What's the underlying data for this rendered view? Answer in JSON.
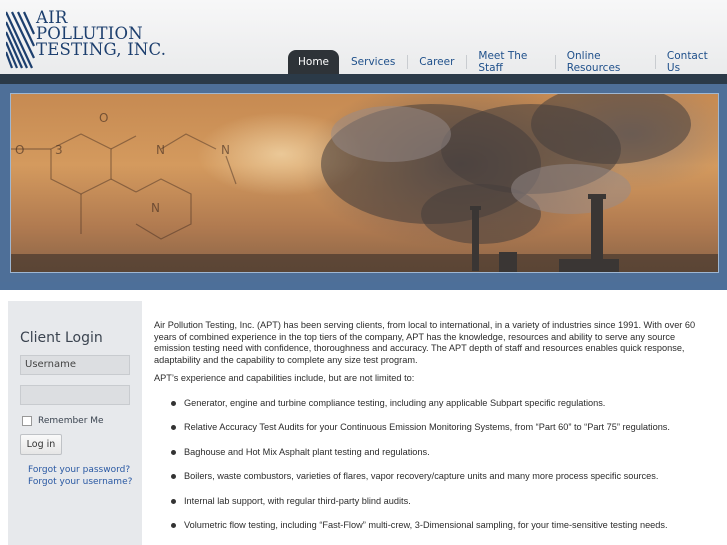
{
  "logo": {
    "line1": "AIR",
    "line2": "POLLUTION",
    "line3": "TESTING, INC."
  },
  "nav": [
    {
      "label": "Home",
      "active": true
    },
    {
      "label": "Services"
    },
    {
      "label": "Career"
    },
    {
      "label": "Meet The Staff"
    },
    {
      "label": "Online Resources"
    },
    {
      "label": "Contact Us"
    }
  ],
  "hero": {
    "chem_labels": [
      "O",
      "O",
      "3",
      "N",
      "N",
      "N"
    ]
  },
  "login": {
    "title": "Client Login",
    "username_placeholder": "Username",
    "remember_label": "Remember Me",
    "login_button": "Log in",
    "forgot_password": "Forgot your password?",
    "forgot_username": "Forgot your username?"
  },
  "main": {
    "intro": "Air Pollution Testing, Inc. (APT) has been serving clients, from local to international, in a variety of industries since 1991.  With over 60 years of combined experience in the top tiers of the company, APT has the knowledge, resources and ability to serve any source emission testing need with confidence, thoroughness and accuracy.  The APT depth of staff and resources enables quick response, adaptability and the capability to complete any size test program.",
    "lead": "APT’s experience and capabilities include, but are not limited to:",
    "capabilities": [
      "Generator, engine and turbine compliance testing, including any applicable Subpart specific regulations.",
      "Relative Accuracy Test Audits for your Continuous Emission Monitoring Systems, from “Part 60” to “Part 75” regulations.",
      "Baghouse and Hot Mix Asphalt plant testing and regulations.",
      "Boilers, waste combustors, varieties of flares, vapor recovery/capture units and many more process specific sources.",
      "Internal lab support, with regular third-party blind audits.",
      "Volumetric flow testing, including “Fast-Flow” multi-crew, 3-Dimensional sampling, for your time-sensitive testing needs."
    ]
  }
}
